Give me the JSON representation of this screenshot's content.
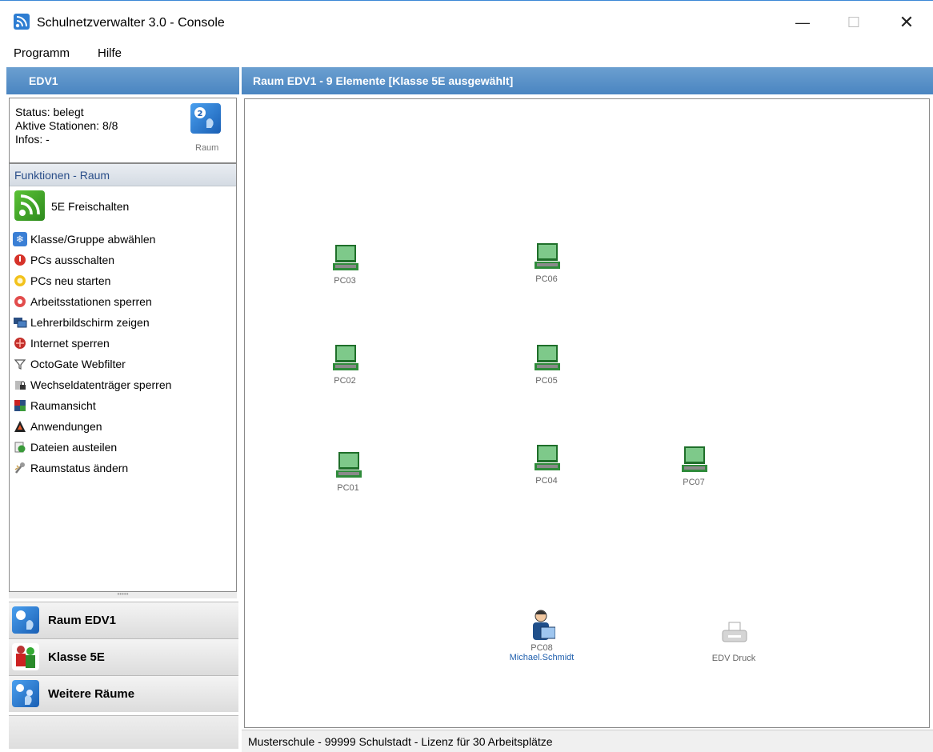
{
  "window": {
    "title": "Schulnetzverwalter 3.0 - Console",
    "minimize": "—",
    "maximize": "☐",
    "close": "✕"
  },
  "menu": [
    "Programm",
    "Hilfe"
  ],
  "left": {
    "header": "EDV1",
    "info": {
      "status": "Status: belegt",
      "active": "Aktive Stationen: 8/8",
      "infos": "Infos: -",
      "raum_label": "Raum"
    },
    "functions_header": "Funktionen - Raum",
    "freischalten": "5E Freischalten",
    "functions": [
      {
        "label": "Klasse/Gruppe abwählen",
        "icon": "deselect-group-icon"
      },
      {
        "label": "PCs ausschalten",
        "icon": "power-off-icon"
      },
      {
        "label": "PCs neu starten",
        "icon": "restart-icon"
      },
      {
        "label": "Arbeitsstationen sperren",
        "icon": "lock-workstation-icon"
      },
      {
        "label": "Lehrerbildschirm zeigen",
        "icon": "show-screen-icon"
      },
      {
        "label": "Internet sperren",
        "icon": "block-internet-icon"
      },
      {
        "label": "OctoGate Webfilter",
        "icon": "filter-icon"
      },
      {
        "label": "Wechseldatenträger sperren",
        "icon": "lock-usb-icon"
      },
      {
        "label": "Raumansicht",
        "icon": "room-view-icon"
      },
      {
        "label": "Anwendungen",
        "icon": "applications-icon"
      },
      {
        "label": "Dateien austeilen",
        "icon": "distribute-files-icon"
      },
      {
        "label": "Raumstatus ändern",
        "icon": "change-status-icon"
      }
    ],
    "splitter": "•••••",
    "nav": [
      {
        "label": "Raum EDV1",
        "icon": "room-icon"
      },
      {
        "label": "Klasse 5E",
        "icon": "class-icon"
      },
      {
        "label": "Weitere Räume",
        "icon": "more-rooms-icon"
      }
    ]
  },
  "right": {
    "header": "Raum EDV1 - 9 Elemente [Klasse 5E ausgewählt]",
    "stations": [
      {
        "name": "PC03",
        "type": "pc"
      },
      {
        "name": "PC06",
        "type": "pc"
      },
      {
        "name": "PC02",
        "type": "pc"
      },
      {
        "name": "PC05",
        "type": "pc"
      },
      {
        "name": "PC01",
        "type": "pc"
      },
      {
        "name": "PC04",
        "type": "pc"
      },
      {
        "name": "PC07",
        "type": "pc"
      },
      {
        "name": "PC08",
        "type": "teacher",
        "user": "Michael.Schmidt"
      },
      {
        "name": "EDV Druck",
        "type": "printer"
      }
    ]
  },
  "statusbar": "Musterschule - 99999 Schulstadt - Lizenz für 30 Arbeitsplätze",
  "colors": {
    "header_blue": "#4a85c1",
    "laptop_green": "#2e8b3a",
    "user_blue": "#1f5fad"
  }
}
